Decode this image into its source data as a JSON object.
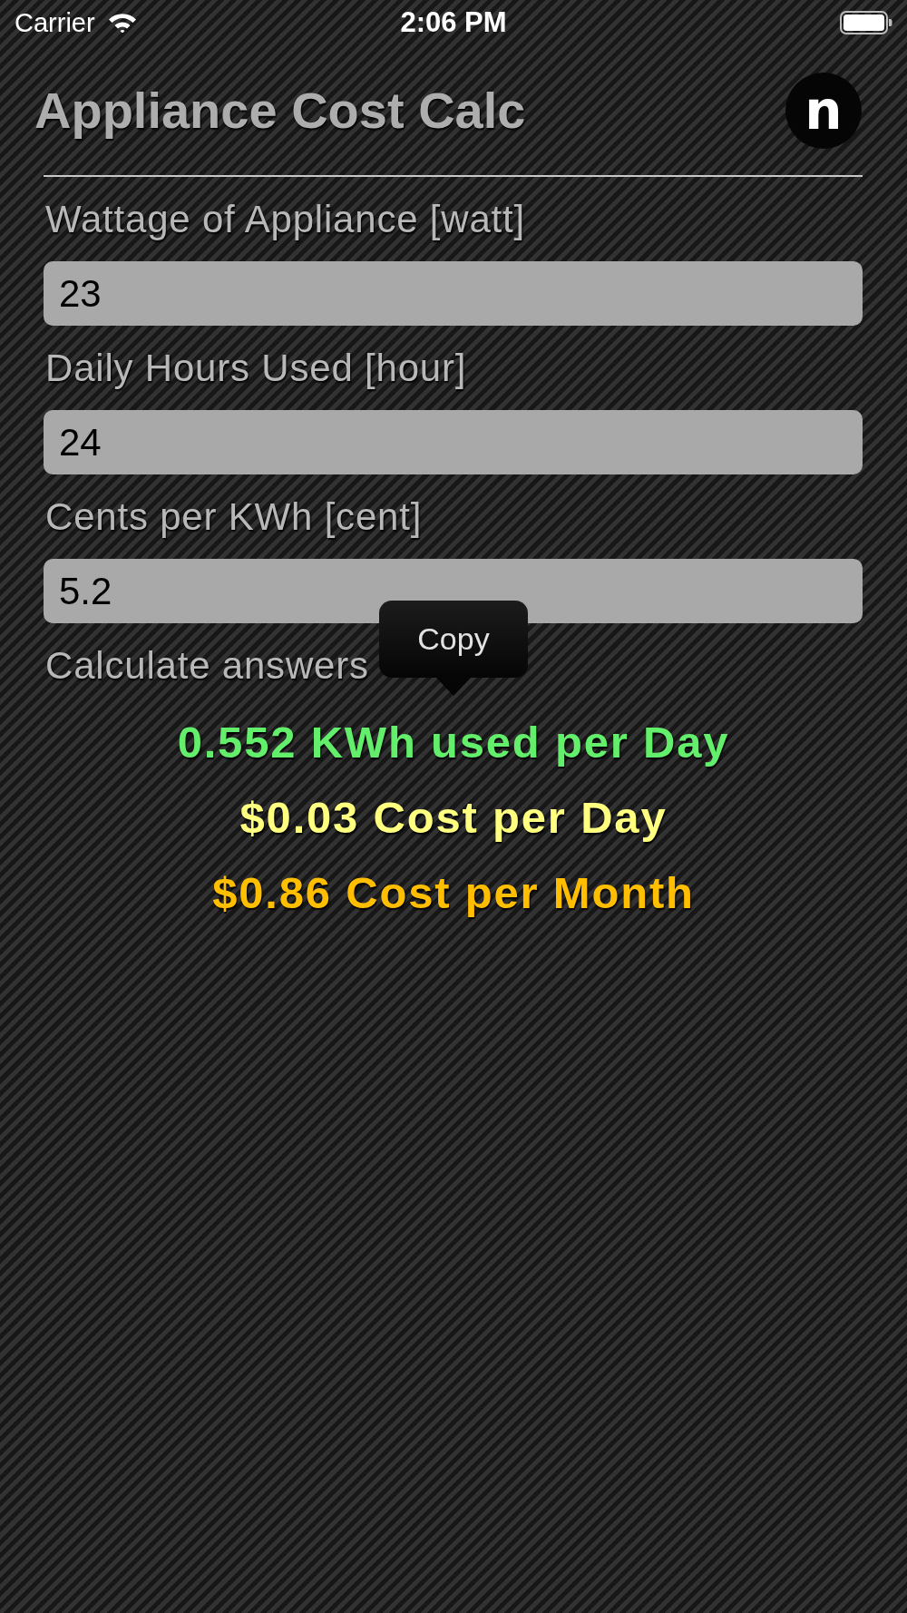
{
  "status_bar": {
    "carrier": "Carrier",
    "time": "2:06 PM"
  },
  "header": {
    "title": "Appliance Cost Calc",
    "logo_letter": "n"
  },
  "fields": [
    {
      "label": "Wattage of Appliance [watt]",
      "value": "23"
    },
    {
      "label": "Daily Hours Used [hour]",
      "value": "24"
    },
    {
      "label": "Cents per KWh [cent]",
      "value": "5.2"
    }
  ],
  "results_heading": "Calculate answers",
  "edit_menu": {
    "items": [
      "Copy"
    ]
  },
  "results": [
    {
      "text": "0.552 KWh used per Day",
      "color": "#63ee6b"
    },
    {
      "text": "$0.03 Cost per Day",
      "color": "#ffff80"
    },
    {
      "text": "$0.86 Cost per Month",
      "color": "#ffbf00"
    }
  ]
}
